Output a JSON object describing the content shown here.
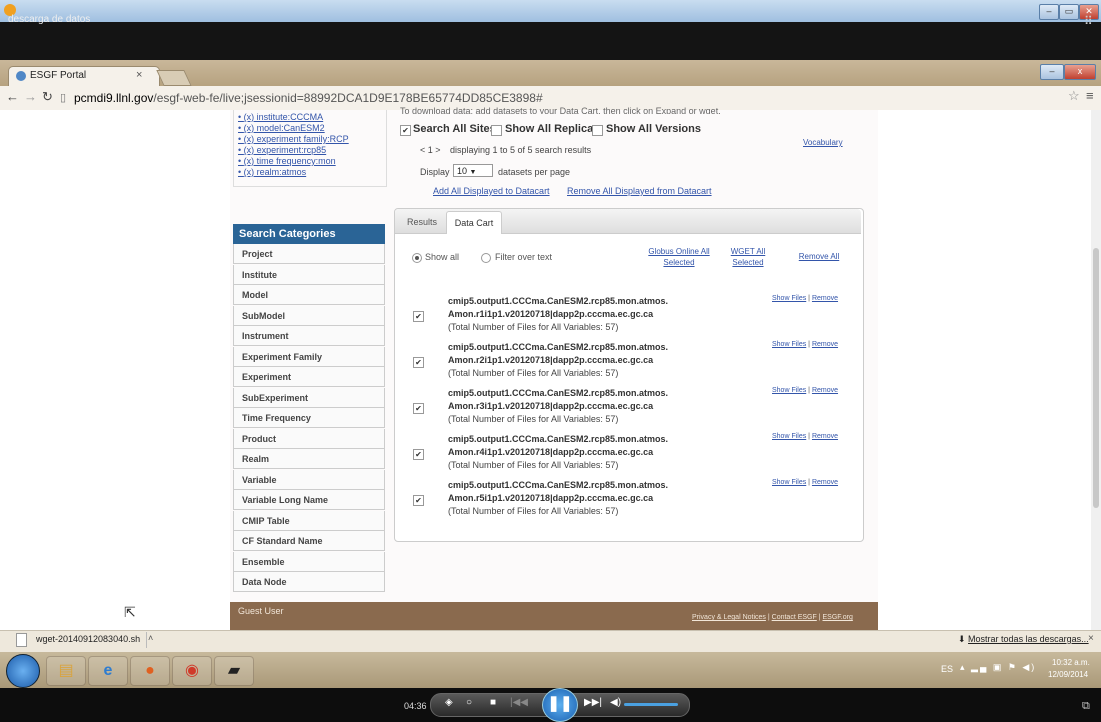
{
  "player": {
    "title": "descarga de datos",
    "time": "04:36",
    "icons": [
      "media-player-logo-icon",
      "stop-icon",
      "prev-icon",
      "pause-icon",
      "next-icon",
      "volume-icon",
      "fullscreen-icon"
    ]
  },
  "browser": {
    "tab_title": "ESGF Portal",
    "tab_close": "×",
    "url_host": "pcmdi9.llnl.gov",
    "url_path": "/esgf-web-fe/live;jsessionid=88992DCA1D9E178BE65774DD85CE3898#"
  },
  "facets": [
    "(x) institute:CCCMA",
    "(x) model:CanESM2",
    "(x) experiment family:RCP",
    "(x) experiment:rcp85",
    "(x) time frequency:mon",
    "(x) realm:atmos"
  ],
  "search_categories": {
    "title": "Search Categories",
    "items": [
      "Project",
      "Institute",
      "Model",
      "SubModel",
      "Instrument",
      "Experiment Family",
      "Experiment",
      "SubExperiment",
      "Time Frequency",
      "Product",
      "Realm",
      "Variable",
      "Variable Long Name",
      "CMIP Table",
      "CF Standard Name",
      "Ensemble",
      "Data Node"
    ]
  },
  "search": {
    "top_text": "To download data: add datasets to your Data Cart, then click on Expand or wget.",
    "vocabulary": "Vocabulary",
    "search_all_sites": "Search All Sites",
    "show_all_replicas": "Show All Replicas",
    "show_all_versions": "Show All Versions",
    "search_all_sites_checked": true,
    "show_all_replicas_checked": false,
    "show_all_versions_checked": false,
    "pager": "< 1 >",
    "displaying": "displaying 1 to 5 of 5 search results",
    "display_label": "Display",
    "display_value": "10",
    "per_page": "datasets per page",
    "add_all": "Add All Displayed to Datacart",
    "remove_all_displayed": "Remove All Displayed from Datacart"
  },
  "cart": {
    "tabs": [
      "Results",
      "Data Cart"
    ],
    "active_tab": "Data Cart",
    "show_all": "Show all",
    "filter_over_text": "Filter over text",
    "globus": "Globus Online All Selected",
    "wget": "WGET All Selected",
    "remove_all": "Remove All",
    "show_files": "Show Files",
    "remove": "Remove",
    "datasets": [
      {
        "line1": "cmip5.output1.CCCma.CanESM2.rcp85.mon.atmos.",
        "line2": "Amon.r1i1p1.v20120718|dapp2p.cccma.ec.gc.ca",
        "files": "(Total Number of Files for All Variables: 57)"
      },
      {
        "line1": "cmip5.output1.CCCma.CanESM2.rcp85.mon.atmos.",
        "line2": "Amon.r2i1p1.v20120718|dapp2p.cccma.ec.gc.ca",
        "files": "(Total Number of Files for All Variables: 57)"
      },
      {
        "line1": "cmip5.output1.CCCma.CanESM2.rcp85.mon.atmos.",
        "line2": "Amon.r3i1p1.v20120718|dapp2p.cccma.ec.gc.ca",
        "files": "(Total Number of Files for All Variables: 57)"
      },
      {
        "line1": "cmip5.output1.CCCma.CanESM2.rcp85.mon.atmos.",
        "line2": "Amon.r4i1p1.v20120718|dapp2p.cccma.ec.gc.ca",
        "files": "(Total Number of Files for All Variables: 57)"
      },
      {
        "line1": "cmip5.output1.CCCma.CanESM2.rcp85.mon.atmos.",
        "line2": "Amon.r5i1p1.v20120718|dapp2p.cccma.ec.gc.ca",
        "files": "(Total Number of Files for All Variables: 57)"
      }
    ]
  },
  "footer": {
    "guest_user": "Guest User",
    "privacy": "Privacy & Legal Notices",
    "contact": "Contact ESGF",
    "esgf_org": "ESGF.org"
  },
  "downloads": {
    "file": "wget-20140912083040.sh",
    "show_all": "Mostrar todas las descargas..."
  },
  "taskbar": {
    "lang": "ES",
    "time": "10:32 a.m.",
    "date": "12/09/2014"
  }
}
